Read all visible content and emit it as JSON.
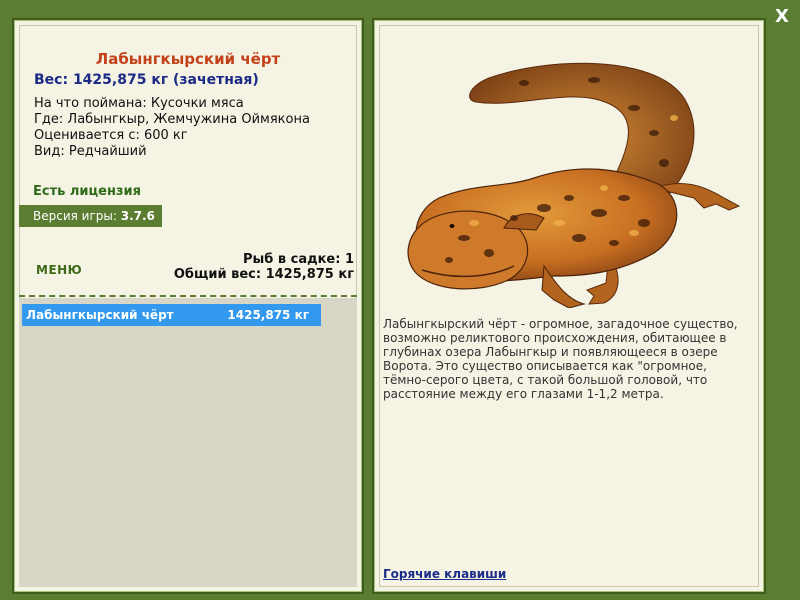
{
  "close_label": "X",
  "fish": {
    "title": "Лабынгкырский чёрт",
    "weight_line": "Вес: 1425,875 кг (зачетная)",
    "caught_on": "На что поймана: Кусочки мяса",
    "location": "Где: Лабынгкыр, Жемчужина Оймякона",
    "valued_from": "Оценивается с: 600 кг",
    "rarity": "Вид: Редчайший",
    "description": "Лабынгкырский чёрт - огромное, загадочное существо, возможно реликтового происхождения, обитающее в глубинах озера Лабынгкыр и появляющееся в озере Ворота. Это существо описывается как \"огромное, тёмно-серого цвета, с такой большой головой, что расстояние между его глазами 1-1,2 метра."
  },
  "license_text": "Есть лицензия",
  "version": {
    "label": "Версия игры: ",
    "value": "3.7.6"
  },
  "menu_label": "МЕНЮ",
  "keepnet": {
    "count_text": "Рыб в садке: 1",
    "total_text": "Общий вес: 1425,875 кг"
  },
  "catch_list": [
    {
      "name": "Лабынгкырский чёрт",
      "weight": "1425,875 кг"
    }
  ],
  "hotkeys_label": "Горячие клавиши",
  "colors": {
    "frame_green": "#5a7d32",
    "panel_bg": "#f5f3e4",
    "title_orange": "#c4421a",
    "weight_blue": "#1b2a86",
    "selected_row": "#3399ee"
  },
  "icons": {
    "close": "close-icon",
    "creature": "salamander-illustration"
  }
}
